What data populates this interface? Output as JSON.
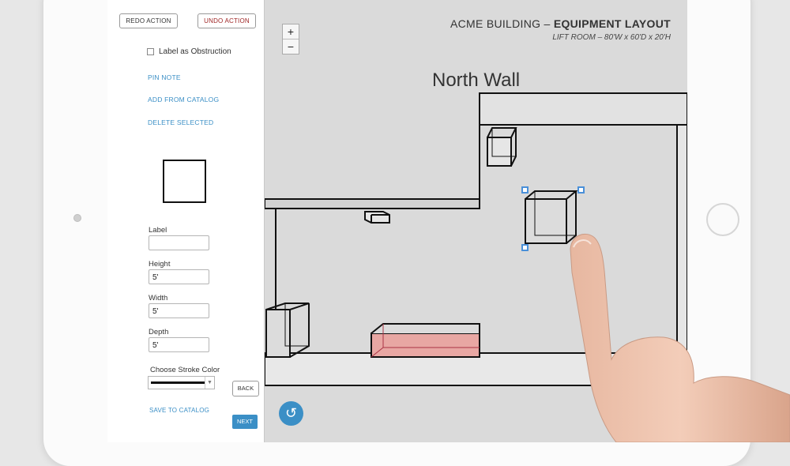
{
  "panel": {
    "redo_label": "REDO ACTION",
    "undo_label": "UNDO ACTION",
    "obstruction_label": "Label as Obstruction",
    "pin_note": "PIN NOTE",
    "add_from_catalog": "ADD FROM CATALOG",
    "delete_selected": "DELETE SELECTED",
    "fields": {
      "label": {
        "label": "Label",
        "value": ""
      },
      "height": {
        "label": "Height",
        "value": "5'"
      },
      "width": {
        "label": "Width",
        "value": "5'"
      },
      "depth": {
        "label": "Depth",
        "value": "5'"
      }
    },
    "stroke_color_label": "Choose Stroke Color",
    "back_label": "BACK",
    "save_to_catalog": "SAVE TO CATALOG",
    "next_label": "NEXT"
  },
  "canvas": {
    "zoom_in": "+",
    "zoom_out": "−",
    "title_prefix": "ACME BUILDING – ",
    "title_bold": "EQUIPMENT LAYOUT",
    "subtitle": "LIFT ROOM – 80'W x 60'D x 20'H",
    "wall_label": "North Wall",
    "undo_icon": "↺"
  },
  "colors": {
    "accent": "#3b8fc6",
    "undo_text": "#a02828",
    "selection": "#4a90d9",
    "highlight_box": "#e8a7a3"
  }
}
